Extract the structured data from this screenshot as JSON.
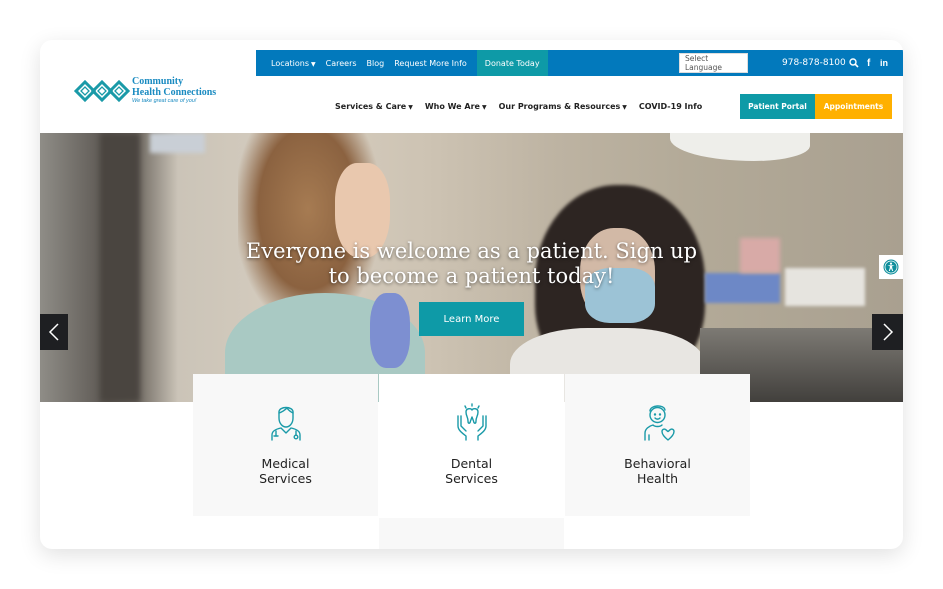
{
  "utility_bar": {
    "links": [
      {
        "label": "Locations",
        "has_dropdown": true
      },
      {
        "label": "Careers"
      },
      {
        "label": "Blog"
      },
      {
        "label": "Request More Info"
      }
    ],
    "donate_label": "Donate Today",
    "language_select": "Select Language",
    "phone": "978-878-8100",
    "icons": [
      "search-icon",
      "facebook-icon",
      "linkedin-icon"
    ],
    "facebook_glyph": "f",
    "linkedin_glyph": "in"
  },
  "logo": {
    "name_line1": "Community",
    "name_line2": "Health Connections",
    "tagline": "We take great care of you!"
  },
  "main_nav": {
    "items": [
      {
        "label": "Services & Care",
        "has_dropdown": true
      },
      {
        "label": "Who We Are",
        "has_dropdown": true
      },
      {
        "label": "Our Programs & Resources",
        "has_dropdown": true
      },
      {
        "label": "COVID-19 Info",
        "has_dropdown": false
      }
    ],
    "caret": "▼"
  },
  "cta": {
    "patient_portal": "Patient Portal",
    "appointments": "Appointments"
  },
  "hero": {
    "title_line1": "Everyone is welcome as a patient. Sign up",
    "title_line2": "to become a patient today!",
    "button_label": "Learn More"
  },
  "services": [
    {
      "icon": "doctor-icon",
      "line1": "Medical",
      "line2": "Services"
    },
    {
      "icon": "tooth-hands-icon",
      "line1": "Dental",
      "line2": "Services"
    },
    {
      "icon": "person-heart-icon",
      "line1": "Behavioral",
      "line2": "Health"
    }
  ],
  "colors": {
    "utility_blue": "#0279bc",
    "teal": "#0e9aa7",
    "amber": "#ffb000",
    "icon_teal": "#1a9aa8"
  }
}
